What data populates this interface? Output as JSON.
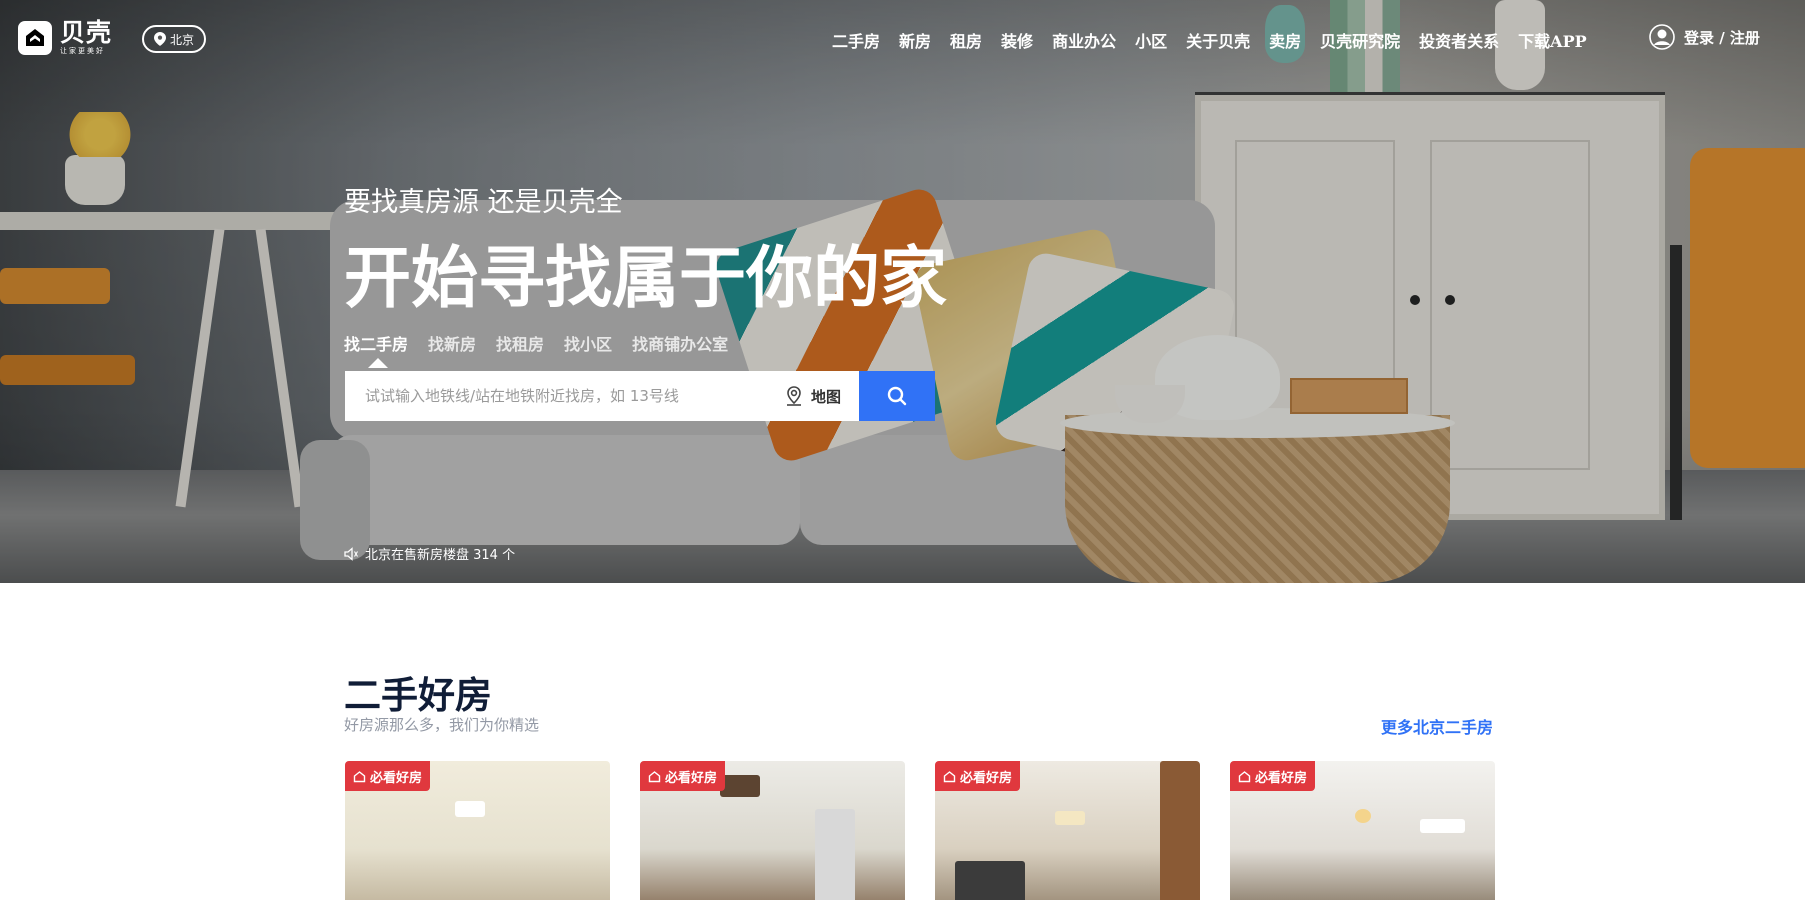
{
  "header": {
    "logo_text": "贝壳",
    "logo_tagline": "让家更美好",
    "city": "北京",
    "nav": [
      "二手房",
      "新房",
      "租房",
      "装修",
      "商业办公",
      "小区",
      "关于贝壳",
      "卖房",
      "贝壳研究院",
      "投资者关系",
      "下载APP"
    ],
    "login_label": "登录 / 注册",
    "icons": {
      "logo": "beike-logo-icon",
      "city": "location-pin-icon",
      "user": "user-icon"
    }
  },
  "hero": {
    "slogan_sub": "要找真房源 还是贝壳全",
    "slogan_main": "开始寻找属于你的家",
    "search_tabs": [
      "找二手房",
      "找新房",
      "找租房",
      "找小区",
      "找商铺办公室"
    ],
    "active_tab": "找二手房",
    "search_placeholder": "试试输入地铁线/站在地铁附近找房，如 13号线",
    "map_label": "地图",
    "notice": "北京在售新房楼盘 314 个",
    "accent": "#3072f6"
  },
  "section": {
    "title": "二手好房",
    "subtitle": "好房源那么多，我们为你精选",
    "more_link": "更多北京二手房",
    "cards": [
      {
        "badge": "必看好房"
      },
      {
        "badge": "必看好房"
      },
      {
        "badge": "必看好房"
      },
      {
        "badge": "必看好房"
      }
    ],
    "badge_color": "#e0383e"
  }
}
